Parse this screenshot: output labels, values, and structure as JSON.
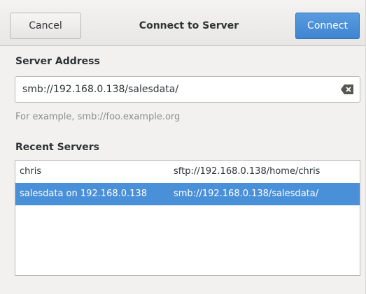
{
  "header": {
    "cancel_label": "Cancel",
    "title": "Connect to Server",
    "connect_label": "Connect"
  },
  "server_address": {
    "label": "Server Address",
    "value": "smb://192.168.0.138/salesdata/",
    "hint": "For example, smb://foo.example.org",
    "clear_icon": "edit-clear-icon"
  },
  "recent": {
    "label": "Recent Servers",
    "rows": [
      {
        "name": "chris",
        "url": "sftp://192.168.0.138/home/chris",
        "selected": false
      },
      {
        "name": "salesdata on 192.168.0.138",
        "url": "smb://192.168.0.138/salesdata/",
        "selected": true
      }
    ]
  },
  "colors": {
    "accent": "#4a90d9",
    "background": "#f2f1f0"
  }
}
